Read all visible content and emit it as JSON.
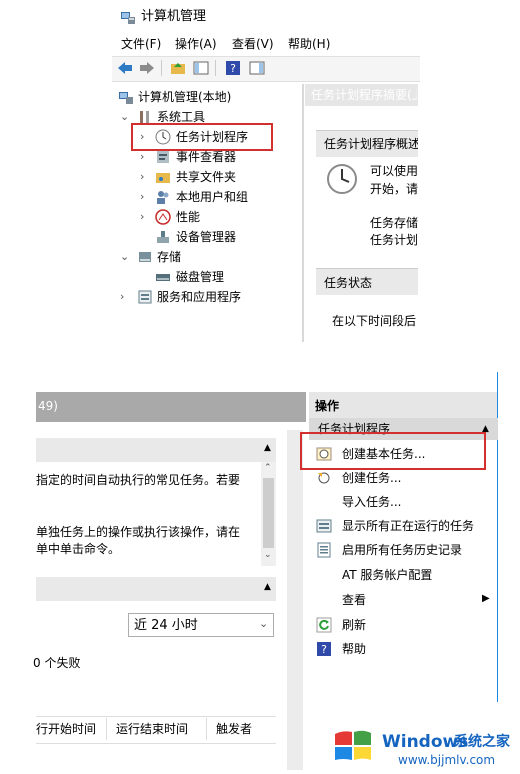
{
  "window": {
    "title": "计算机管理"
  },
  "menubar": {
    "file": "文件(F)",
    "action": "操作(A)",
    "view": "查看(V)",
    "help": "帮助(H)"
  },
  "tree": {
    "root": "计算机管理(本地)",
    "system_tools": "系统工具",
    "task_scheduler": "任务计划程序",
    "event_viewer": "事件查看器",
    "shared_folders": "共享文件夹",
    "local_users": "本地用户和组",
    "performance": "性能",
    "device_manager": "设备管理器",
    "storage": "存储",
    "disk_management": "磁盘管理",
    "services_apps": "服务和应用程序"
  },
  "top_panel": {
    "header": "任务计划程序摘要(上",
    "overview_title": "任务计划程序概述",
    "overview_line1": "可以使用",
    "overview_line2": "开始，请",
    "overview_line3": "任务存储",
    "overview_line4": "任务计划",
    "status_title": "任务状态",
    "status_line": "在以下时间段后"
  },
  "bottom_panel": {
    "header_fragment": "49)",
    "desc_line1": "指定的时间自动执行的常见任务。若要",
    "desc_line2": "单独任务上的操作或执行该操作，请在",
    "desc_line3": "单中单击命令。",
    "range_select": "近 24 小时",
    "fail_text": "0 个失败",
    "col_start": "行开始时间",
    "col_end": "运行结束时间",
    "col_trigger": "触发者"
  },
  "actions": {
    "title": "操作",
    "section": "任务计划程序",
    "items": {
      "create_basic": "创建基本任务...",
      "create_task": "创建任务...",
      "import_task": "导入任务...",
      "show_running": "显示所有正在运行的任务",
      "enable_history": "启用所有任务历史记录",
      "at_service": "AT 服务帐户配置",
      "view": "查看",
      "refresh": "刷新",
      "help": "帮助"
    }
  },
  "watermark": {
    "brand": "Windows",
    "site_name": "系统之家",
    "url": "www.bjjmlv.com"
  },
  "colors": {
    "highlight_red": "#d32f2f",
    "panel_grey": "#e6e6e6",
    "accent_blue": "#1565c0"
  }
}
